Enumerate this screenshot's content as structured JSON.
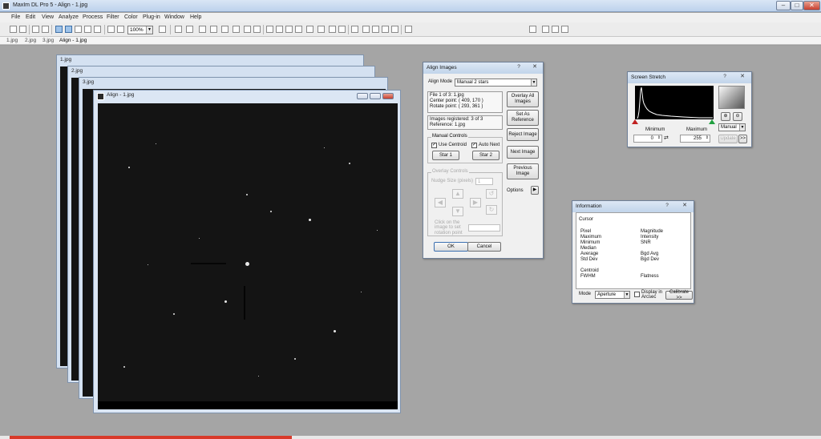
{
  "app": {
    "title": "MaxIm DL Pro 5 - Align - 1.jpg"
  },
  "menu": [
    "File",
    "Edit",
    "View",
    "Analyze",
    "Process",
    "Filter",
    "Color",
    "Plug-in",
    "Window",
    "Help"
  ],
  "toolbar": {
    "zoom": "100%"
  },
  "tabs": [
    "1.jpg",
    "2.jpg",
    "3.jpg",
    "Align - 1.jpg"
  ],
  "windows": {
    "w1": "1.jpg",
    "w2": "2.jpg",
    "w3": "3.jpg",
    "w4": "Align - 1.jpg"
  },
  "align_dialog": {
    "title": "Align Images",
    "mode_label": "Align Mode",
    "mode_value": "Manual 2 stars",
    "file_info": [
      "File 1 of 3:  1.jpg",
      "Center point: ( 409, 170 )",
      "Rotate point: ( 293, 361 )"
    ],
    "reg_info": [
      "Images registered: 3 of 3",
      "Reference: 1.jpg"
    ],
    "manual_controls": "Manual Controls",
    "use_centroid": "Use Centroid",
    "auto_next": "Auto Next",
    "star1": "Star 1",
    "star2": "Star 2",
    "overlay_controls": "Overlay Controls",
    "nudge_size": "Nudge Size (pixels)",
    "nudge_value": "1",
    "click_hint": "Click on the image to set rotation point",
    "overlay_all": "Overlay All Images",
    "set_reference": "Set As Reference",
    "reject_image": "Reject Image",
    "next_image": "Next Image",
    "previous_image": "Previous Image",
    "options": "Options",
    "ok": "OK",
    "cancel": "Cancel"
  },
  "stretch_dialog": {
    "title": "Screen Stretch",
    "minimum_label": "Minimum",
    "maximum_label": "Maximum",
    "minimum_value": "0",
    "maximum_value": "255",
    "mode": "Manual",
    "update": "Update",
    "more": ">>"
  },
  "info_dialog": {
    "title": "Information",
    "cursor_label": "Cursor",
    "left_fields": [
      "Pixel",
      "Maximum",
      "Minimum",
      "Median",
      "Average",
      "Std Dev",
      "",
      "Centroid",
      "FWHM"
    ],
    "right_fields": [
      "Magnitude",
      "Intensity",
      "SNR",
      "",
      "Bgd Avg",
      "Bgd Dev",
      "",
      "",
      "Flatness"
    ],
    "mode_label": "Mode",
    "mode_value": "Aperture",
    "display_arcsec": "Display in Arcsec",
    "calibrate": "Calibrate >>"
  }
}
